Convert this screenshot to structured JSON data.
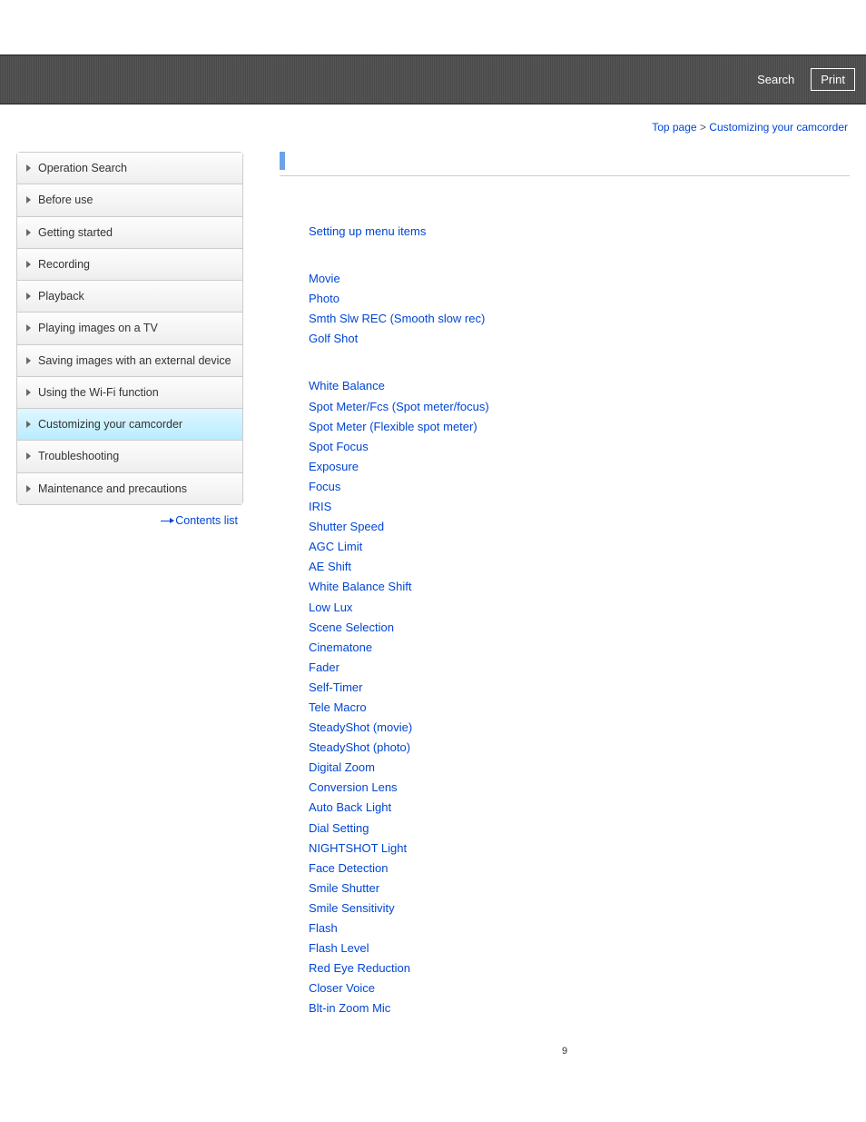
{
  "header": {
    "search_label": "Search",
    "print_label": "Print"
  },
  "breadcrumb": {
    "top_page": "Top page",
    "separator": " > ",
    "current": "Customizing your camcorder"
  },
  "sidebar": {
    "items": [
      {
        "label": "Operation Search",
        "active": false
      },
      {
        "label": "Before use",
        "active": false
      },
      {
        "label": "Getting started",
        "active": false
      },
      {
        "label": "Recording",
        "active": false
      },
      {
        "label": "Playback",
        "active": false
      },
      {
        "label": "Playing images on a TV",
        "active": false
      },
      {
        "label": "Saving images with an external device",
        "active": false
      },
      {
        "label": "Using the Wi-Fi function",
        "active": false
      },
      {
        "label": "Customizing your camcorder",
        "active": true
      },
      {
        "label": "Troubleshooting",
        "active": false
      },
      {
        "label": "Maintenance and precautions",
        "active": false
      }
    ],
    "contents_list": "Contents list"
  },
  "main": {
    "group1": [
      "Setting up menu items"
    ],
    "group2": [
      "Movie",
      "Photo",
      "Smth Slw REC (Smooth slow rec)",
      "Golf Shot"
    ],
    "group3": [
      "White Balance",
      "Spot Meter/Fcs (Spot meter/focus)",
      "Spot Meter (Flexible spot meter)",
      "Spot Focus",
      "Exposure",
      "Focus",
      "IRIS",
      "Shutter Speed",
      "AGC Limit",
      "AE Shift",
      "White Balance Shift",
      "Low Lux",
      "Scene Selection",
      "Cinematone",
      "Fader",
      "Self-Timer",
      "Tele Macro",
      "SteadyShot (movie)",
      "SteadyShot (photo)",
      "Digital Zoom",
      "Conversion Lens",
      "Auto Back Light",
      "Dial Setting",
      "NIGHTSHOT Light",
      "Face Detection",
      "Smile Shutter",
      "Smile Sensitivity",
      "Flash",
      "Flash Level",
      "Red Eye Reduction",
      "Closer Voice",
      "Blt-in Zoom Mic"
    ]
  },
  "page_number": "9"
}
